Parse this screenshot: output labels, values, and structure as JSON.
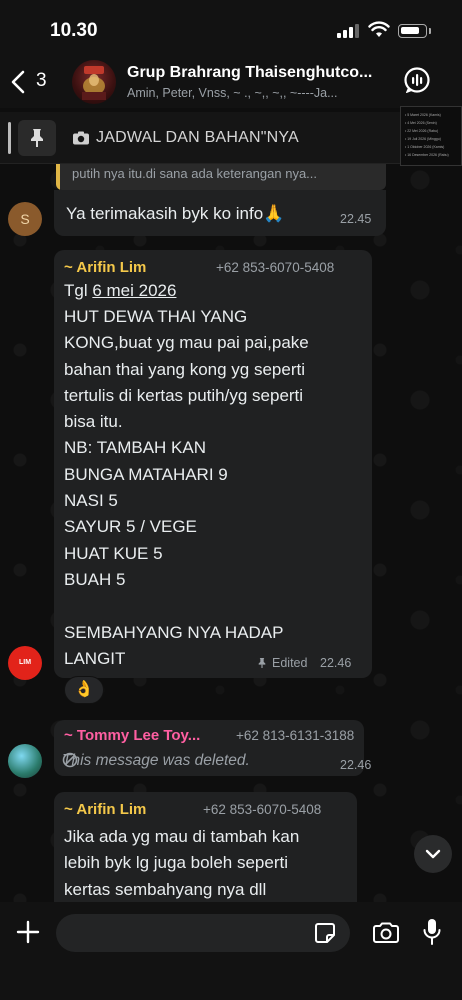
{
  "status_bar": {
    "time": "10.30",
    "battery_level": 0.82
  },
  "header": {
    "unread_count": "3",
    "group_name": "Grup Brahrang Thaisenghutco...",
    "members": "Amin, Peter, Vnss, ~ ., ~,, ~,, ~----Ja..."
  },
  "pinned": {
    "text": "JADWAL DAN BAHAN\"NYA",
    "thumbnail_lines": [
      "• 5 Maret 2026 (Kamis)",
      "• 4 Mei 2026 (Senin)",
      "• 22 Mei 2026 (Rabu)",
      "• 19 Juli 2026 (Minggu)",
      "• 1 Oktober 2026 (Kamis)",
      "• 16 Desember 2026 (Rabu)"
    ]
  },
  "messages": {
    "quoted_fragment": "putih nya itu.di sana ada keterangan nya...",
    "reply_s": {
      "avatar_letter": "S",
      "text": "Ya terimakasih byk ko info🙏",
      "time": "22.45"
    },
    "arifin_1": {
      "sender": "~ Arifin Lim",
      "phone": "+62 853-6070-5408",
      "body_prefix": "Tgl ",
      "body_date_link": "6 mei 2026",
      "body": "HUT DEWA THAI YANG\nKONG,buat yg mau pai pai,pake\nbahan thai yang kong yg seperti\ntertulis di kertas putih/yg seperti\nbisa itu.\nNB: TAMBAH KAN\nBUNGA MATAHARI 9\nNASI 5\nSAYUR 5 / VEGE\nHUAT KUE 5\nBUAH 5\n\nSEMBAHYANG NYA HADAP\nLANGIT",
      "edited_label": "Edited",
      "time": "22.46",
      "reaction": "👌",
      "avatar_text": "LIM"
    },
    "tommy": {
      "sender": "~ Tommy Lee Toy...",
      "phone": "+62 813-6131-3188",
      "deleted_text": "This message was deleted.",
      "time": "22.46"
    },
    "arifin_2": {
      "sender": "~ Arifin Lim",
      "phone": "+62 853-6070-5408",
      "body": "Jika ada yg mau di tambah kan\nlebih byk lg juga boleh seperti\nkertas sembahyang nya dll"
    }
  },
  "input_bar": {
    "placeholder": ""
  },
  "colors": {
    "arifin_name": "#f4c84a",
    "tommy_name": "#ff5fa2",
    "bubble": "#202122",
    "background": "#0e0e0e",
    "link": "#e9edef"
  },
  "icons": [
    "back-icon",
    "call-icon",
    "pin-icon",
    "camera-icon",
    "check-icon",
    "deleted-icon",
    "chevron-down-icon",
    "plus-icon",
    "sticker-icon",
    "mic-icon"
  ]
}
